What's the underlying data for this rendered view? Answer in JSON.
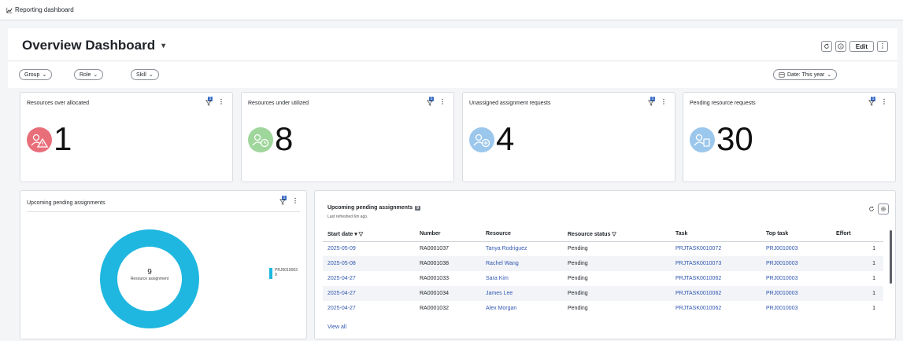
{
  "topbar": {
    "breadcrumb": "Reporting dashboard",
    "icon": "chart-icon"
  },
  "header": {
    "title": "Overview Dashboard",
    "buttons": {
      "refresh": "refresh-icon",
      "info": "info-icon",
      "edit_label": "Edit",
      "more": "more-icon"
    }
  },
  "filters": {
    "group": "Group",
    "role": "Role",
    "skill": "Skill",
    "date": "Date: This year"
  },
  "kpis": [
    {
      "label": "Resources over allocated",
      "value": "1",
      "filter_count": "1",
      "icon": "resource-warning-icon",
      "color": "#e86f7a"
    },
    {
      "label": "Resources under utilized",
      "value": "8",
      "filter_count": "1",
      "icon": "resource-clock-icon",
      "color": "#9fd69b"
    },
    {
      "label": "Unassigned assignment requests",
      "value": "4",
      "filter_count": "1",
      "icon": "resource-add-icon",
      "color": "#9cc7ec"
    },
    {
      "label": "Pending resource requests",
      "value": "30",
      "filter_count": "1",
      "icon": "resource-doc-icon",
      "color": "#9cc7ec"
    }
  ],
  "left_panel": {
    "title": "Upcoming pending assignments",
    "filter_count": "1",
    "donut_value": "9",
    "donut_label": "Resource assignment",
    "legend": {
      "name": "PRJ0010003",
      "value": "9",
      "color": "#1fb7e0"
    }
  },
  "right_panel": {
    "title": "Upcoming pending assignments",
    "count_badge": "9",
    "subtitle": "Last refreshed 6m ago.",
    "columns": [
      "Start date",
      "Number",
      "Resource",
      "Resource status",
      "Task",
      "Top task",
      "Effort"
    ],
    "rows": [
      {
        "start": "2025-05-09",
        "number": "RA0001037",
        "resource": "Tanya Rodriguez",
        "status": "Pending",
        "task": "PRJTASK0010072",
        "top": "PRJ0010003",
        "effort": "1"
      },
      {
        "start": "2025-05-08",
        "number": "RA0001038",
        "resource": "Rachel Wang",
        "status": "Pending",
        "task": "PRJTASK0010073",
        "top": "PRJ0010003",
        "effort": "1"
      },
      {
        "start": "2025-04-27",
        "number": "RA0001033",
        "resource": "Sara Kim",
        "status": "Pending",
        "task": "PRJTASK0010062",
        "top": "PRJ0010003",
        "effort": "1"
      },
      {
        "start": "2025-04-27",
        "number": "RA0001034",
        "resource": "James Lee",
        "status": "Pending",
        "task": "PRJTASK0010062",
        "top": "PRJ0010003",
        "effort": "1"
      },
      {
        "start": "2025-04-27",
        "number": "RA0001032",
        "resource": "Alex Morgan",
        "status": "Pending",
        "task": "PRJTASK0010062",
        "top": "PRJ0010003",
        "effort": "1"
      }
    ],
    "view_all": "View all"
  }
}
